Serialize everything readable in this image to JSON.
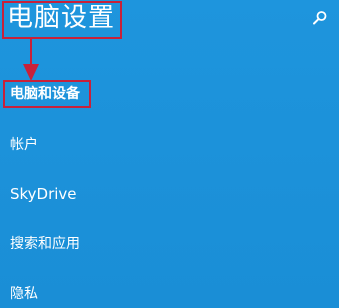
{
  "header": {
    "title": "电脑设置"
  },
  "nav": {
    "items": [
      {
        "label": "电脑和设备"
      },
      {
        "label": "帐户"
      },
      {
        "label": "SkyDrive"
      },
      {
        "label": "搜索和应用"
      },
      {
        "label": "隐私"
      }
    ]
  },
  "colors": {
    "background": "#1b8fd8",
    "highlight_border": "#c8213a",
    "text": "#ffffff"
  },
  "icons": {
    "search": "search-icon",
    "annotation": "down-arrow-icon"
  }
}
